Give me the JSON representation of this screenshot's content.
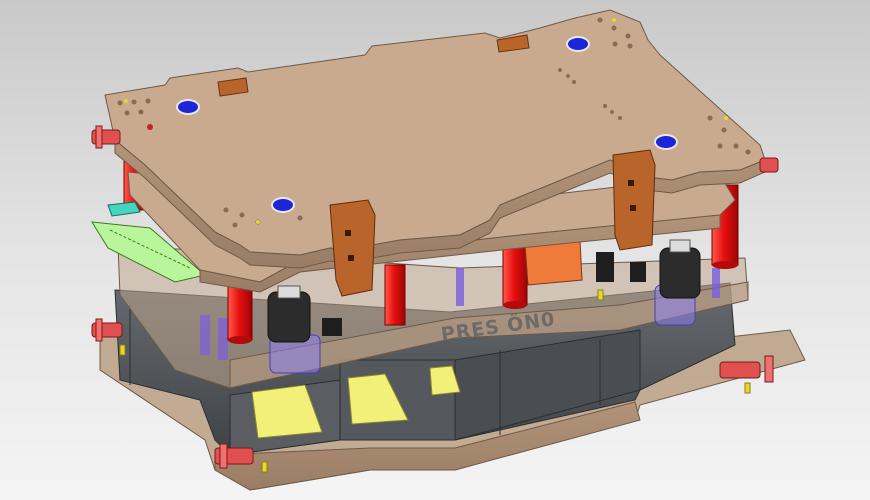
{
  "die_label": "PRES ÖN0",
  "colors": {
    "background_top": "#c9c9c9",
    "background_bottom": "#f4f4f4",
    "plate": "#c9aa8f",
    "plate_edge": "#a78a70",
    "pillar": "#e81010",
    "lower_block": "#4e5256",
    "insert_yellow": "#f3f07a",
    "strip_green": "#b9f59a",
    "bracket_orange": "#b8642a"
  }
}
